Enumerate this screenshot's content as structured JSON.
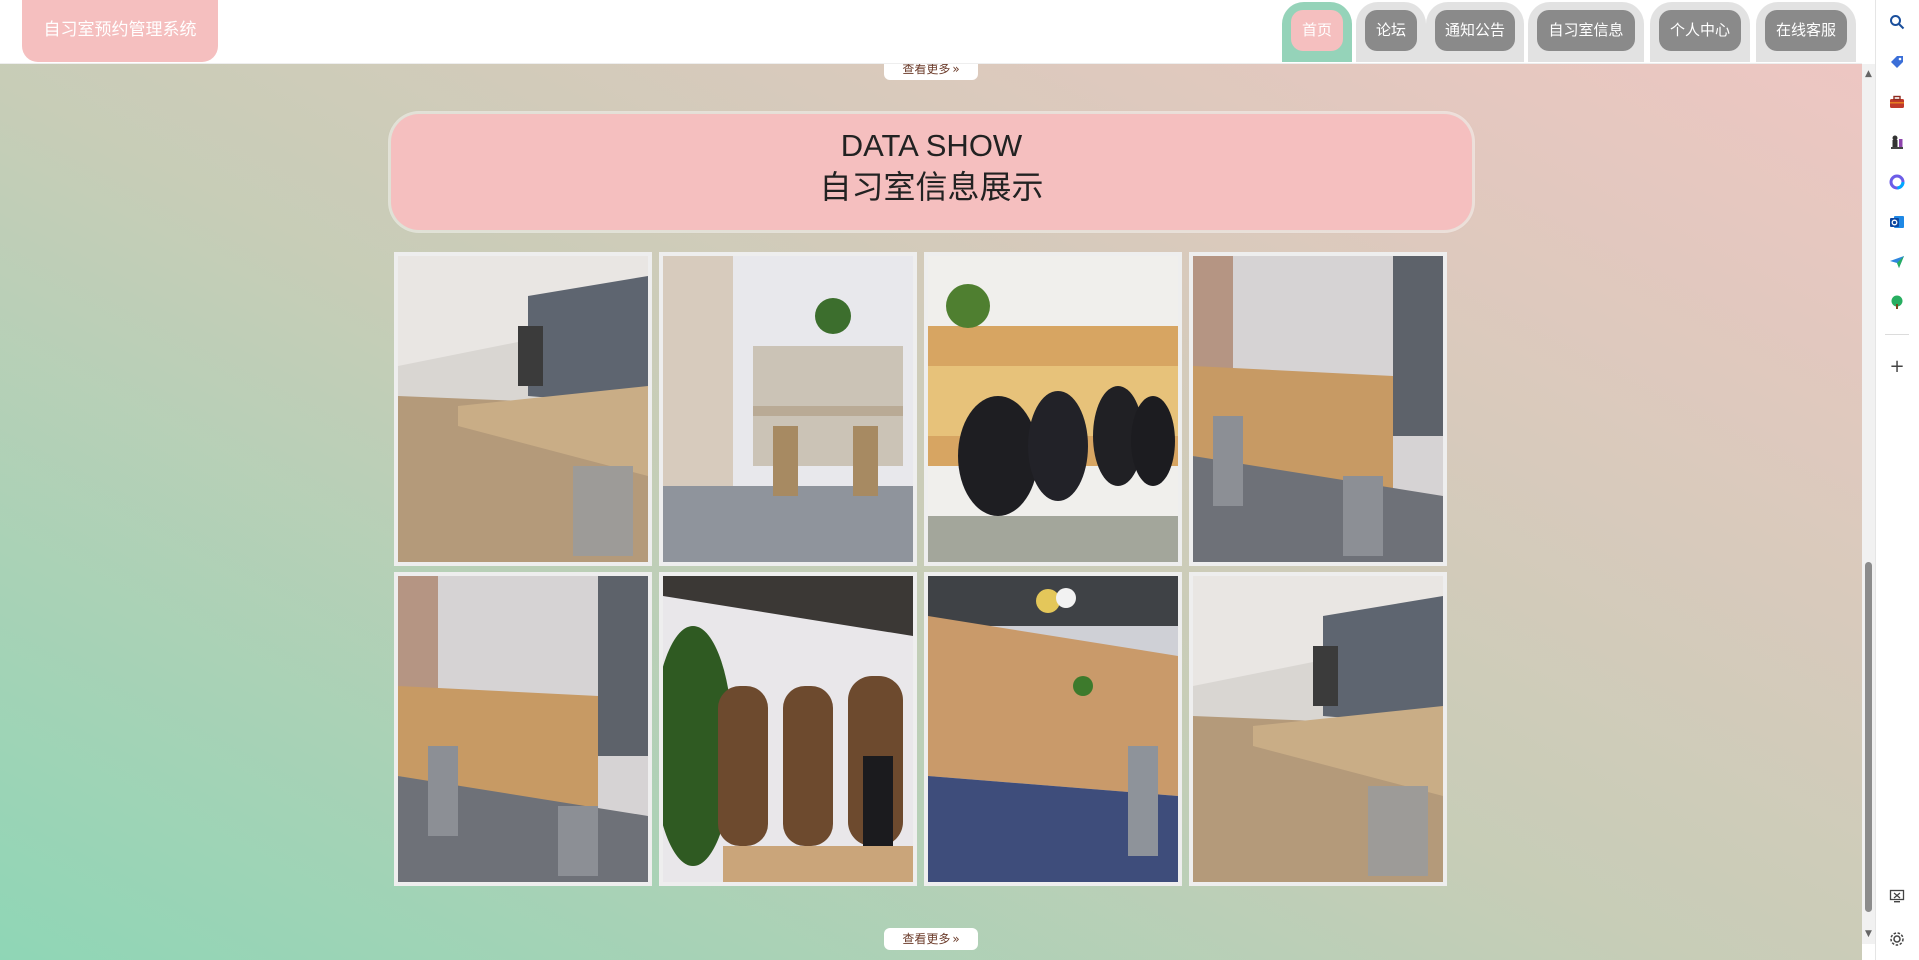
{
  "header": {
    "brand": "自习室预约管理系统",
    "nav": [
      {
        "label": "首页",
        "active": true
      },
      {
        "label": "论坛",
        "active": false
      },
      {
        "label": "通知公告",
        "active": false
      },
      {
        "label": "自习室信息",
        "active": false
      },
      {
        "label": "个人中心",
        "active": false
      },
      {
        "label": "在线客服",
        "active": false
      }
    ]
  },
  "main": {
    "more_label": "查看更多",
    "more_icon": "»",
    "section_title_en": "DATA SHOW",
    "section_title_cn": "自习室信息展示",
    "gallery": [
      {
        "name": "study-room-photo-1"
      },
      {
        "name": "study-room-photo-2"
      },
      {
        "name": "study-room-photo-3"
      },
      {
        "name": "study-room-photo-4"
      },
      {
        "name": "study-room-photo-5"
      },
      {
        "name": "study-room-photo-6"
      },
      {
        "name": "study-room-photo-7"
      },
      {
        "name": "study-room-photo-8"
      }
    ]
  },
  "sidebar_icons": [
    "search-icon",
    "tag-icon",
    "briefcase-icon",
    "chess-icon",
    "copilot-icon",
    "outlook-icon",
    "send-icon",
    "tree-icon",
    "add-icon",
    "screenshot-icon",
    "settings-icon"
  ],
  "colors": {
    "accent_pink": "#f5bfbf",
    "accent_green": "#95d3b9",
    "tab_gray": "#8a8a8a"
  }
}
